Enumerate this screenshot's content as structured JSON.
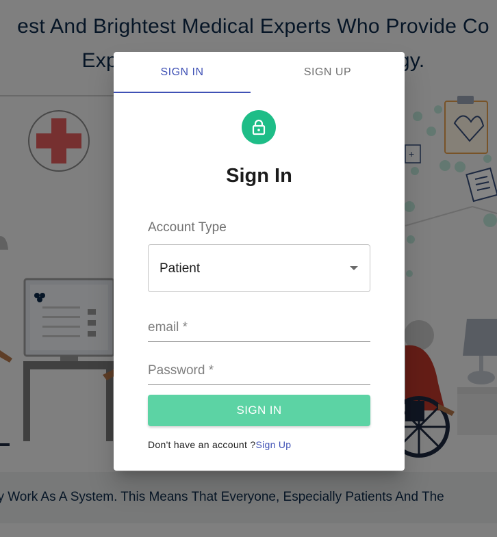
{
  "background": {
    "hero_line1": "est And Brightest Medical Experts Who Provide Co",
    "hero_line2": "Expertise And Advanced Technology.",
    "bottom_line": "lly Work As A System. This Means That Everyone, Especially Patients And The"
  },
  "dialog": {
    "tabs": [
      {
        "label": "SIGN IN",
        "active": true
      },
      {
        "label": "SIGN UP",
        "active": false
      }
    ],
    "avatar_icon": "lock-icon",
    "title": "Sign In",
    "account_type": {
      "label": "Account Type",
      "selected": "Patient"
    },
    "email": {
      "placeholder": "email *",
      "value": ""
    },
    "password": {
      "placeholder": "Password *",
      "value": ""
    },
    "submit_label": "SIGN IN",
    "footer_text": "Don't have an account ?",
    "footer_link": "Sign Up"
  },
  "colors": {
    "primary": "#3f51b5",
    "accent_green": "#1ebd87",
    "button_green": "#5cd3a4"
  }
}
